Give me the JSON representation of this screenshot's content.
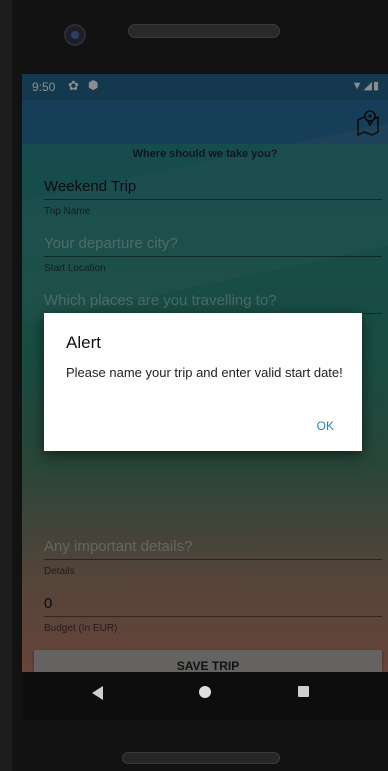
{
  "status_bar": {
    "time": "9:50"
  },
  "content": {
    "prompt": "Where should we take you?",
    "fields": {
      "trip_name": {
        "value": "Weekend Trip",
        "label": "Trip Name"
      },
      "start_location": {
        "placeholder": "Your departure city?",
        "label": "Start Location"
      },
      "places": {
        "placeholder": "Which places are you travelling to?"
      },
      "details": {
        "placeholder": "Any important details?",
        "label": "Details"
      },
      "budget": {
        "value": "0",
        "label": "Budget (In EUR)"
      }
    },
    "save_label": "SAVE TRIP"
  },
  "alert": {
    "title": "Alert",
    "message": "Please name your trip and enter valid start date!",
    "ok_label": "OK"
  },
  "colors": {
    "app_bar": "#2b72a0",
    "status_bar": "#25688e",
    "dialog_button": "#1e86c9"
  }
}
